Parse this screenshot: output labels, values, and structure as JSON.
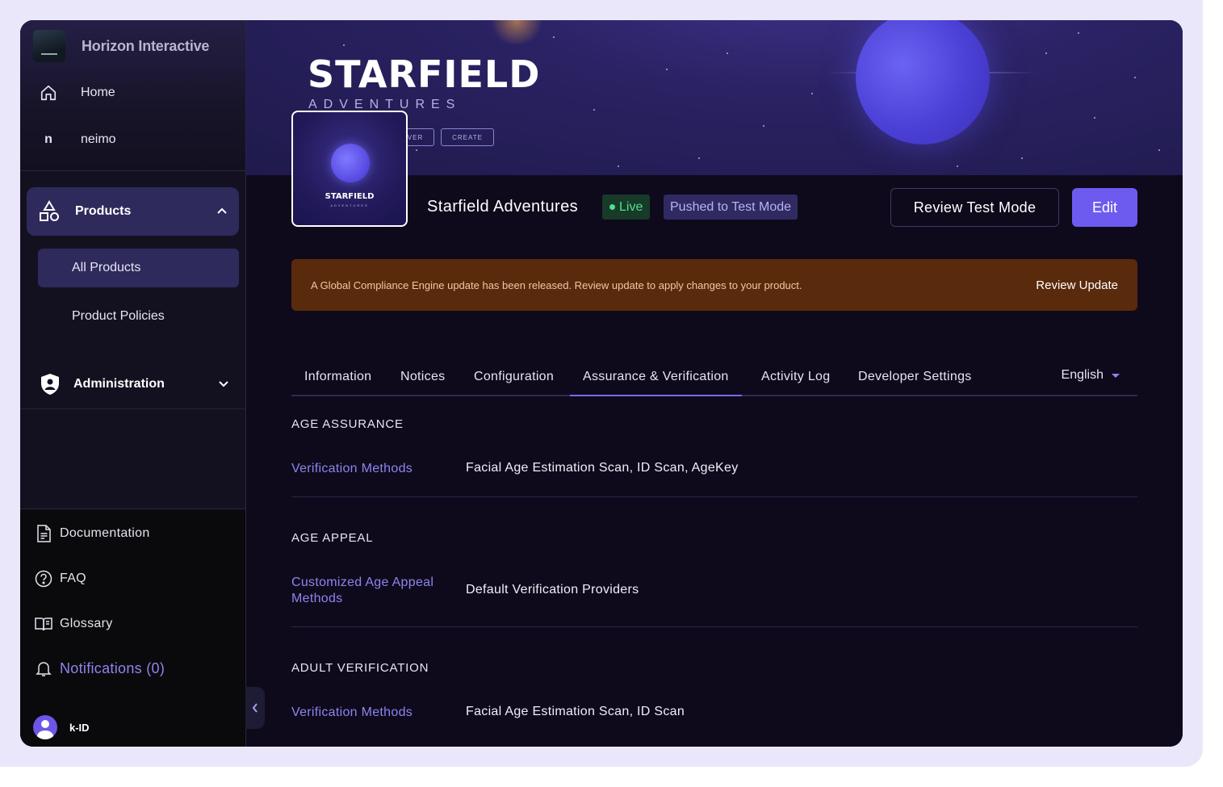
{
  "sidebar": {
    "org_name": "Horizon Interactive",
    "nav": [
      {
        "label": "Home",
        "icon": "home-icon"
      },
      {
        "label": "neimo",
        "icon_letter": "n"
      }
    ],
    "products": {
      "label": "Products",
      "icon": "shapes-icon",
      "expanded": true
    },
    "sub_items": [
      "All Products",
      "Product Policies"
    ],
    "administration": {
      "label": "Administration",
      "icon": "shield-icon"
    },
    "bottom": [
      {
        "label": "Documentation",
        "icon": "document-icon"
      },
      {
        "label": "FAQ",
        "icon": "question-icon"
      },
      {
        "label": "Glossary",
        "icon": "book-icon"
      },
      {
        "label": "Notifications (0)",
        "icon": "bell-icon"
      }
    ],
    "user": {
      "name": "k-ID"
    }
  },
  "banner": {
    "title": "STARFIELD",
    "subtitle": "ADVENTURES",
    "buttons": [
      "VER",
      "CREATE"
    ]
  },
  "thumbnail": {
    "title": "STARFIELD",
    "subtitle": "ADVENTURES"
  },
  "product": {
    "name": "Starfield Adventures",
    "status_live": "Live",
    "status_test": "Pushed to Test Mode",
    "review_button": "Review Test Mode",
    "edit_button": "Edit"
  },
  "alert": {
    "text": "A Global Compliance Engine update has been released. Review update to apply changes to your product.",
    "link": "Review Update"
  },
  "tabs": [
    "Information",
    "Notices",
    "Configuration",
    "Assurance & Verification",
    "Activity Log",
    "Developer Settings"
  ],
  "active_tab": "Assurance & Verification",
  "language": "English",
  "sections": [
    {
      "heading": "AGE ASSURANCE",
      "label": "Verification Methods",
      "value": "Facial Age Estimation Scan, ID Scan, AgeKey"
    },
    {
      "heading": "AGE APPEAL",
      "label": "Customized Age Appeal Methods",
      "value": "Default Verification Providers"
    },
    {
      "heading": "ADULT VERIFICATION",
      "label": "Verification Methods",
      "value": "Facial Age Estimation Scan, ID Scan"
    }
  ],
  "colors": {
    "accent": "#6d5bf0",
    "link": "#8f84ee",
    "live": "#4fe08d",
    "alert_bg": "#5a2a0c"
  }
}
